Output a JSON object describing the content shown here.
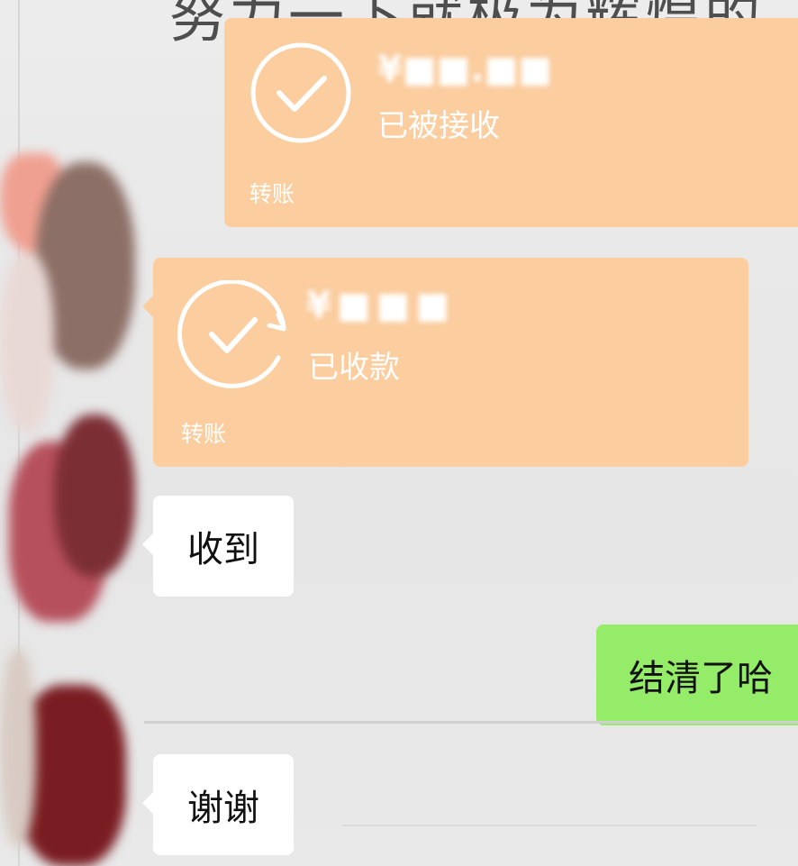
{
  "header": {
    "partial_text": "努力一下就极为辉煌的"
  },
  "messages": [
    {
      "type": "transfer",
      "side": "right",
      "amount_text": "¥■■.■■",
      "status": "已被接收",
      "label": "转账",
      "icon": "check-circle-icon"
    },
    {
      "type": "transfer",
      "side": "left",
      "amount_text": "¥■■■",
      "status": "已收款",
      "label": "转账",
      "icon": "check-circle-icon"
    },
    {
      "type": "text",
      "side": "left",
      "text": "收到"
    },
    {
      "type": "text",
      "side": "right",
      "text": "结清了哈"
    },
    {
      "type": "text",
      "side": "left",
      "text": "谢谢"
    }
  ],
  "colors": {
    "transfer_bg": "#fbcd9f",
    "sent_bubble": "#95ec69",
    "received_bubble": "#ffffff",
    "chat_bg": "#e9e9e9"
  }
}
